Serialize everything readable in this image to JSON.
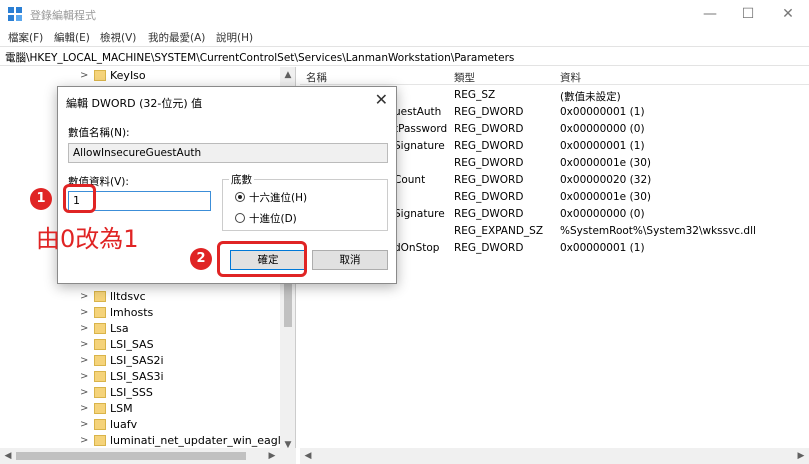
{
  "window": {
    "title": "登錄編輯程式"
  },
  "menu": [
    "檔案(F)",
    "編輯(E)",
    "檢視(V)",
    "我的最愛(A)",
    "說明(H)"
  ],
  "address": "電腦\\HKEY_LOCAL_MACHINE\\SYSTEM\\CurrentControlSet\\Services\\LanmanWorkstation\\Parameters",
  "tree": {
    "items": [
      "KeyIso",
      "lltdsvc",
      "lmhosts",
      "Lsa",
      "LSI_SAS",
      "LSI_SAS2i",
      "LSI_SAS3i",
      "LSI_SSS",
      "LSM",
      "luafv",
      "luminati_net_updater_win_eaglege"
    ]
  },
  "list": {
    "headers": {
      "name": "名稱",
      "type": "類型",
      "data": "資料"
    },
    "rows": [
      {
        "name": "",
        "type": "REG_SZ",
        "data": "(數值未設定)"
      },
      {
        "name": "uestAuth",
        "type": "REG_DWORD",
        "data": "0x00000001 (1)"
      },
      {
        "name": "tPassword",
        "type": "REG_DWORD",
        "data": "0x00000000 (0)"
      },
      {
        "name": "Signature",
        "type": "REG_DWORD",
        "data": "0x00000001 (1)"
      },
      {
        "name": "",
        "type": "REG_DWORD",
        "data": "0x0000001e (30)"
      },
      {
        "name": "Count",
        "type": "REG_DWORD",
        "data": "0x00000020 (32)"
      },
      {
        "name": "",
        "type": "REG_DWORD",
        "data": "0x0000001e (30)"
      },
      {
        "name": "Signature",
        "type": "REG_DWORD",
        "data": "0x00000000 (0)"
      },
      {
        "name": "",
        "type": "REG_EXPAND_SZ",
        "data": "%SystemRoot%\\System32\\wkssvc.dll"
      },
      {
        "name": "dOnStop",
        "type": "REG_DWORD",
        "data": "0x00000001 (1)"
      }
    ]
  },
  "dialog": {
    "title": "編輯 DWORD (32-位元) 值",
    "name_label": "數值名稱(N):",
    "name_value": "AllowInsecureGuestAuth",
    "data_label": "數值資料(V):",
    "data_value": "1",
    "base_label": "底數",
    "radio_hex": "十六進位(H)",
    "radio_dec": "十進位(D)",
    "ok": "確定",
    "cancel": "取消"
  },
  "annotations": {
    "step1": "1",
    "step2": "2",
    "note": "由0改為1",
    "color": "#e02424"
  }
}
